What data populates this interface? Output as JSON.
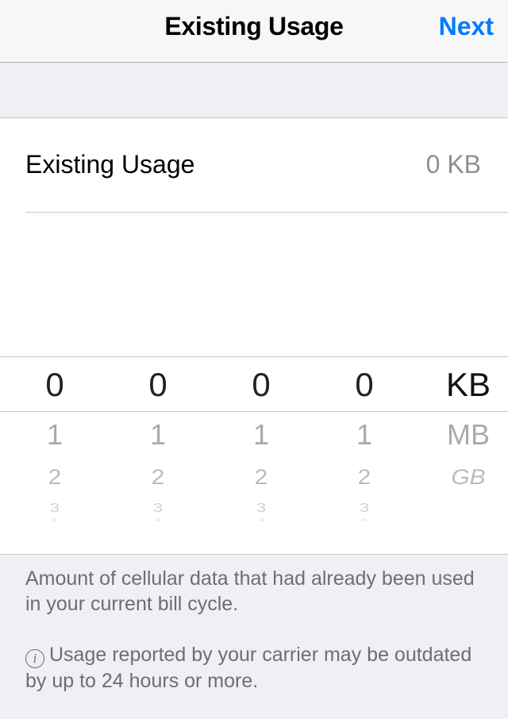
{
  "navbar": {
    "title": "Existing Usage",
    "next_label": "Next"
  },
  "usage_row": {
    "label": "Existing Usage",
    "value": "0 KB"
  },
  "picker": {
    "digit_columns": [
      {
        "selected": "0",
        "below": [
          "1",
          "2",
          "3",
          "4"
        ]
      },
      {
        "selected": "0",
        "below": [
          "1",
          "2",
          "3",
          "4"
        ]
      },
      {
        "selected": "0",
        "below": [
          "1",
          "2",
          "3",
          "4"
        ]
      },
      {
        "selected": "0",
        "below": [
          "1",
          "2",
          "3",
          "4"
        ]
      }
    ],
    "unit_column": {
      "selected": "KB",
      "below": [
        "MB",
        "GB"
      ]
    }
  },
  "footer": {
    "description": "Amount of cellular data that had already been used in your current bill cycle.",
    "info_icon": "info-circle-icon",
    "info_glyph": "i",
    "note": "Usage reported by your carrier may be outdated by up to 24 hours or more."
  },
  "colors": {
    "accent": "#007aff",
    "background": "#efeff4",
    "secondary_text": "#8e8e93"
  }
}
